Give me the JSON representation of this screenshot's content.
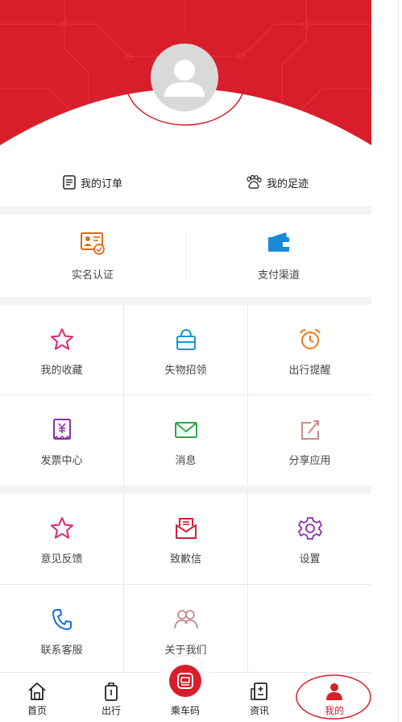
{
  "colors": {
    "brand": "#d81e2b",
    "background": "#ffffff",
    "separator": "#f3f3f3"
  },
  "quick_links": [
    {
      "label": "我的订单",
      "icon": "order-list-icon"
    },
    {
      "label": "我的足迹",
      "icon": "footprint-icon"
    }
  ],
  "account": [
    {
      "label": "实名认证",
      "icon": "id-verify-icon"
    },
    {
      "label": "支付渠道",
      "icon": "wallet-icon"
    }
  ],
  "grid_a": [
    {
      "label": "我的收藏",
      "icon": "star-icon"
    },
    {
      "label": "失物招领",
      "icon": "bag-icon"
    },
    {
      "label": "出行提醒",
      "icon": "alarm-clock-icon"
    },
    {
      "label": "发票中心",
      "icon": "invoice-icon"
    },
    {
      "label": "消息",
      "icon": "envelope-icon"
    },
    {
      "label": "分享应用",
      "icon": "share-icon"
    }
  ],
  "grid_b": [
    {
      "label": "意见反馈",
      "icon": "star-outline-icon"
    },
    {
      "label": "致歉信",
      "icon": "letter-icon"
    },
    {
      "label": "设置",
      "icon": "gear-icon"
    },
    {
      "label": "联系客服",
      "icon": "phone-icon"
    },
    {
      "label": "关于我们",
      "icon": "users-icon"
    }
  ],
  "tabbar": [
    {
      "label": "首页",
      "icon": "home-icon"
    },
    {
      "label": "出行",
      "icon": "luggage-icon"
    },
    {
      "label": "乘车码",
      "icon": "metro-code-icon"
    },
    {
      "label": "资讯",
      "icon": "news-icon"
    },
    {
      "label": "我的",
      "icon": "profile-icon",
      "active": true
    }
  ]
}
